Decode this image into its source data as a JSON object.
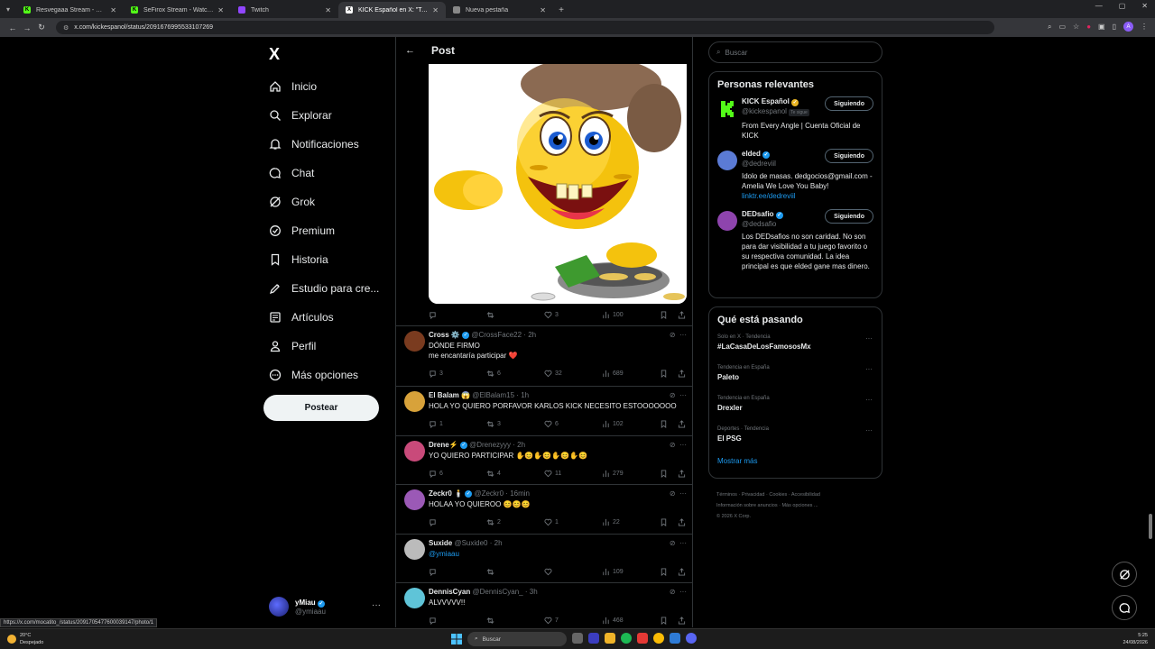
{
  "browser": {
    "tabs": [
      {
        "title": "Resvegaaa Stream - Watch Live",
        "fav_color": "#53fc18",
        "fav_letter": "K"
      },
      {
        "title": "SeFirox Stream - Watch Live on",
        "fav_color": "#53fc18",
        "fav_letter": "K"
      },
      {
        "title": "Twitch",
        "fav_color": "#9146ff",
        "fav_letter": ""
      },
      {
        "title": "KICK Español en X: \"Todo va a s",
        "fav_color": "#ffffff",
        "fav_letter": "X"
      },
      {
        "title": "Nueva pestaña",
        "fav_color": "#888888",
        "fav_letter": ""
      }
    ],
    "url": "x.com/kickespanol/status/2091676995533107269",
    "profile_initial": "A"
  },
  "nav": {
    "logo": "X",
    "items": [
      {
        "label": "Inicio",
        "icon": "home-icon"
      },
      {
        "label": "Explorar",
        "icon": "search-icon"
      },
      {
        "label": "Notificaciones",
        "icon": "bell-icon"
      },
      {
        "label": "Chat",
        "icon": "chat-icon"
      },
      {
        "label": "Grok",
        "icon": "grok-icon"
      },
      {
        "label": "Premium",
        "icon": "premium-icon"
      },
      {
        "label": "Historia",
        "icon": "bookmark-icon"
      },
      {
        "label": "Estudio para cre...",
        "icon": "rocket-icon"
      },
      {
        "label": "Artículos",
        "icon": "article-icon"
      },
      {
        "label": "Perfil",
        "icon": "person-icon"
      },
      {
        "label": "Más opciones",
        "icon": "more-icon"
      }
    ],
    "post_button": "Postear",
    "account": {
      "name": "yMiau",
      "handle": "@ymiaau"
    }
  },
  "status_url": "https://x.com/mocatito_/status/2091705477600039147/photo/1",
  "center": {
    "title": "Post",
    "main_actions": {
      "replies": "",
      "reposts": "",
      "likes": "3",
      "views": "100"
    },
    "replies": [
      {
        "name": "Cross",
        "badge": "⚙️",
        "verified": true,
        "handle": "@CrossFace22",
        "time": "2h",
        "lines": [
          "DÓNDE FIRMO",
          "me encantaría participar ❤️"
        ],
        "replies": "3",
        "reposts": "6",
        "likes": "32",
        "views": "689",
        "avatar": "#7a3b1f"
      },
      {
        "name": "El Balam",
        "badge": "😱",
        "verified": false,
        "handle": "@ElBalam15",
        "time": "1h",
        "lines": [
          "HOLA YO QUIERO PORFAVOR KARLOS KICK NECESITO ESTOOOOOOO"
        ],
        "replies": "1",
        "reposts": "3",
        "likes": "6",
        "views": "102",
        "avatar": "#d8a23a"
      },
      {
        "name": "Drene⚡",
        "badge": "",
        "verified": true,
        "handle": "@Drenezyyy",
        "time": "2h",
        "lines": [
          "YO QUIERO PARTICIPAR ✋😊✋😊✋😊✋😊"
        ],
        "replies": "6",
        "reposts": "4",
        "likes": "11",
        "views": "279",
        "avatar": "#c94a7a"
      },
      {
        "name": "Zeckr0",
        "badge": "🕯️",
        "verified": true,
        "handle": "@Zeckr0",
        "time": "16min",
        "lines": [
          "HOLAA YO QUIEROO 😊😊😊"
        ],
        "replies": "",
        "reposts": "2",
        "likes": "1",
        "views": "22",
        "avatar": "#9b59b6"
      },
      {
        "name": "Suxide",
        "badge": "",
        "verified": false,
        "handle": "@Suxide0",
        "time": "2h",
        "lines": [
          "@ymiaau"
        ],
        "link": true,
        "replies": "",
        "reposts": "",
        "likes": "",
        "views": "109",
        "avatar": "#bbbbbb"
      },
      {
        "name": "DennisCyan",
        "badge": "",
        "verified": false,
        "handle": "@DennisCyan_",
        "time": "3h",
        "lines": [
          "ALVVVVV!!"
        ],
        "replies": "",
        "reposts": "",
        "likes": "7",
        "views": "468",
        "avatar": "#5fc4d8"
      }
    ]
  },
  "right": {
    "search_placeholder": "Buscar",
    "people_title": "Personas relevantes",
    "people": [
      {
        "name": "KICK Español",
        "handle": "@kickespanol",
        "follows_you": "Te sigue",
        "bio": "From Every Angle | Cuenta Oficial de KICK",
        "link": "",
        "button": "Siguiendo",
        "avatar": "#000000"
      },
      {
        "name": "elded",
        "handle": "@dedreviil",
        "follows_you": "",
        "bio": "Idolo de masas. dedgocios@gmail.com - Amelia We Love You Baby!",
        "link": "linktr.ee/dedreviil",
        "button": "Siguiendo",
        "avatar": "#5b7bd5"
      },
      {
        "name": "DEDsafio",
        "handle": "@dedsafio",
        "follows_you": "",
        "bio": "Los DEDsafios no son caridad. No son para dar visibilidad a tu juego favorito o su respectiva comunidad. La idea principal es que elded gane mas dinero.",
        "link": "",
        "button": "Siguiendo",
        "avatar": "#8e44ad"
      }
    ],
    "trends_title": "Qué está pasando",
    "trends": [
      {
        "meta": "Solo en X · Tendencia",
        "name": "#LaCasaDeLosFamososMx"
      },
      {
        "meta": "Tendencia en España",
        "name": "Paleto"
      },
      {
        "meta": "Tendencia en España",
        "name": "Drexler"
      },
      {
        "meta": "Deportes · Tendencia",
        "name": "El PSG"
      }
    ],
    "show_more": "Mostrar más",
    "footer": [
      "Términos",
      "Privacidad",
      "Cookies",
      "Accesibilidad",
      "Información sobre anuncios",
      "Más opciones ...",
      "© 2026 X Corp."
    ]
  },
  "taskbar": {
    "temp": "20°C",
    "weather": "Despejado",
    "search": "Buscar",
    "time": "5:25",
    "date": "24/08/2026"
  },
  "colors": {
    "accent": "#1d9bf0",
    "kick_green": "#53fc18",
    "background": "#000000"
  }
}
